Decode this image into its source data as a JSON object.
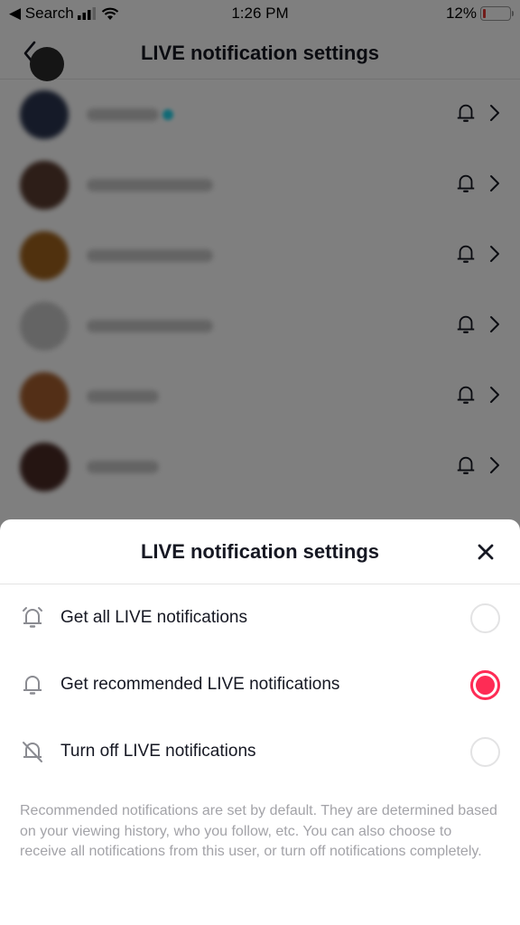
{
  "status_bar": {
    "back_app": "◀ Search",
    "time": "1:26 PM",
    "battery_percent": "12%",
    "battery_level": 0.12
  },
  "nav": {
    "title": "LIVE notification settings",
    "back_icon": "chevron-left-icon"
  },
  "user_list": {
    "rows": [
      {
        "avatar_color": "#2b3550",
        "verified": true,
        "name_width_hint": "short"
      },
      {
        "avatar_color": "#5a3c30",
        "verified": false,
        "name_width_hint": "long"
      },
      {
        "avatar_color": "#a0621c",
        "verified": false,
        "name_width_hint": "long"
      },
      {
        "avatar_color": "#c9c9c9",
        "verified": false,
        "name_width_hint": "long"
      },
      {
        "avatar_color": "#a65f2e",
        "verified": false,
        "name_width_hint": "short"
      },
      {
        "avatar_color": "#4a2a25",
        "verified": false,
        "name_width_hint": "short"
      }
    ],
    "row_icons": [
      "bell-icon",
      "chevron-right-icon"
    ]
  },
  "sheet": {
    "title": "LIVE notification settings",
    "close_icon": "close-icon",
    "options": [
      {
        "label": "Get all LIVE notifications",
        "icon": "bell-ringing-icon",
        "selected": false
      },
      {
        "label": "Get recommended LIVE notifications",
        "icon": "bell-icon",
        "selected": true
      },
      {
        "label": "Turn off LIVE notifications",
        "icon": "bell-off-icon",
        "selected": false
      }
    ],
    "description": "Recommended notifications are set by default. They are determined based on your viewing history, who you follow, etc. You can also choose to receive all notifications from this user, or turn off notifications completely."
  },
  "colors": {
    "accent": "#fe2c55",
    "text_primary": "#161823",
    "text_secondary": "#a3a3a8",
    "divider": "#e3e3e4"
  }
}
